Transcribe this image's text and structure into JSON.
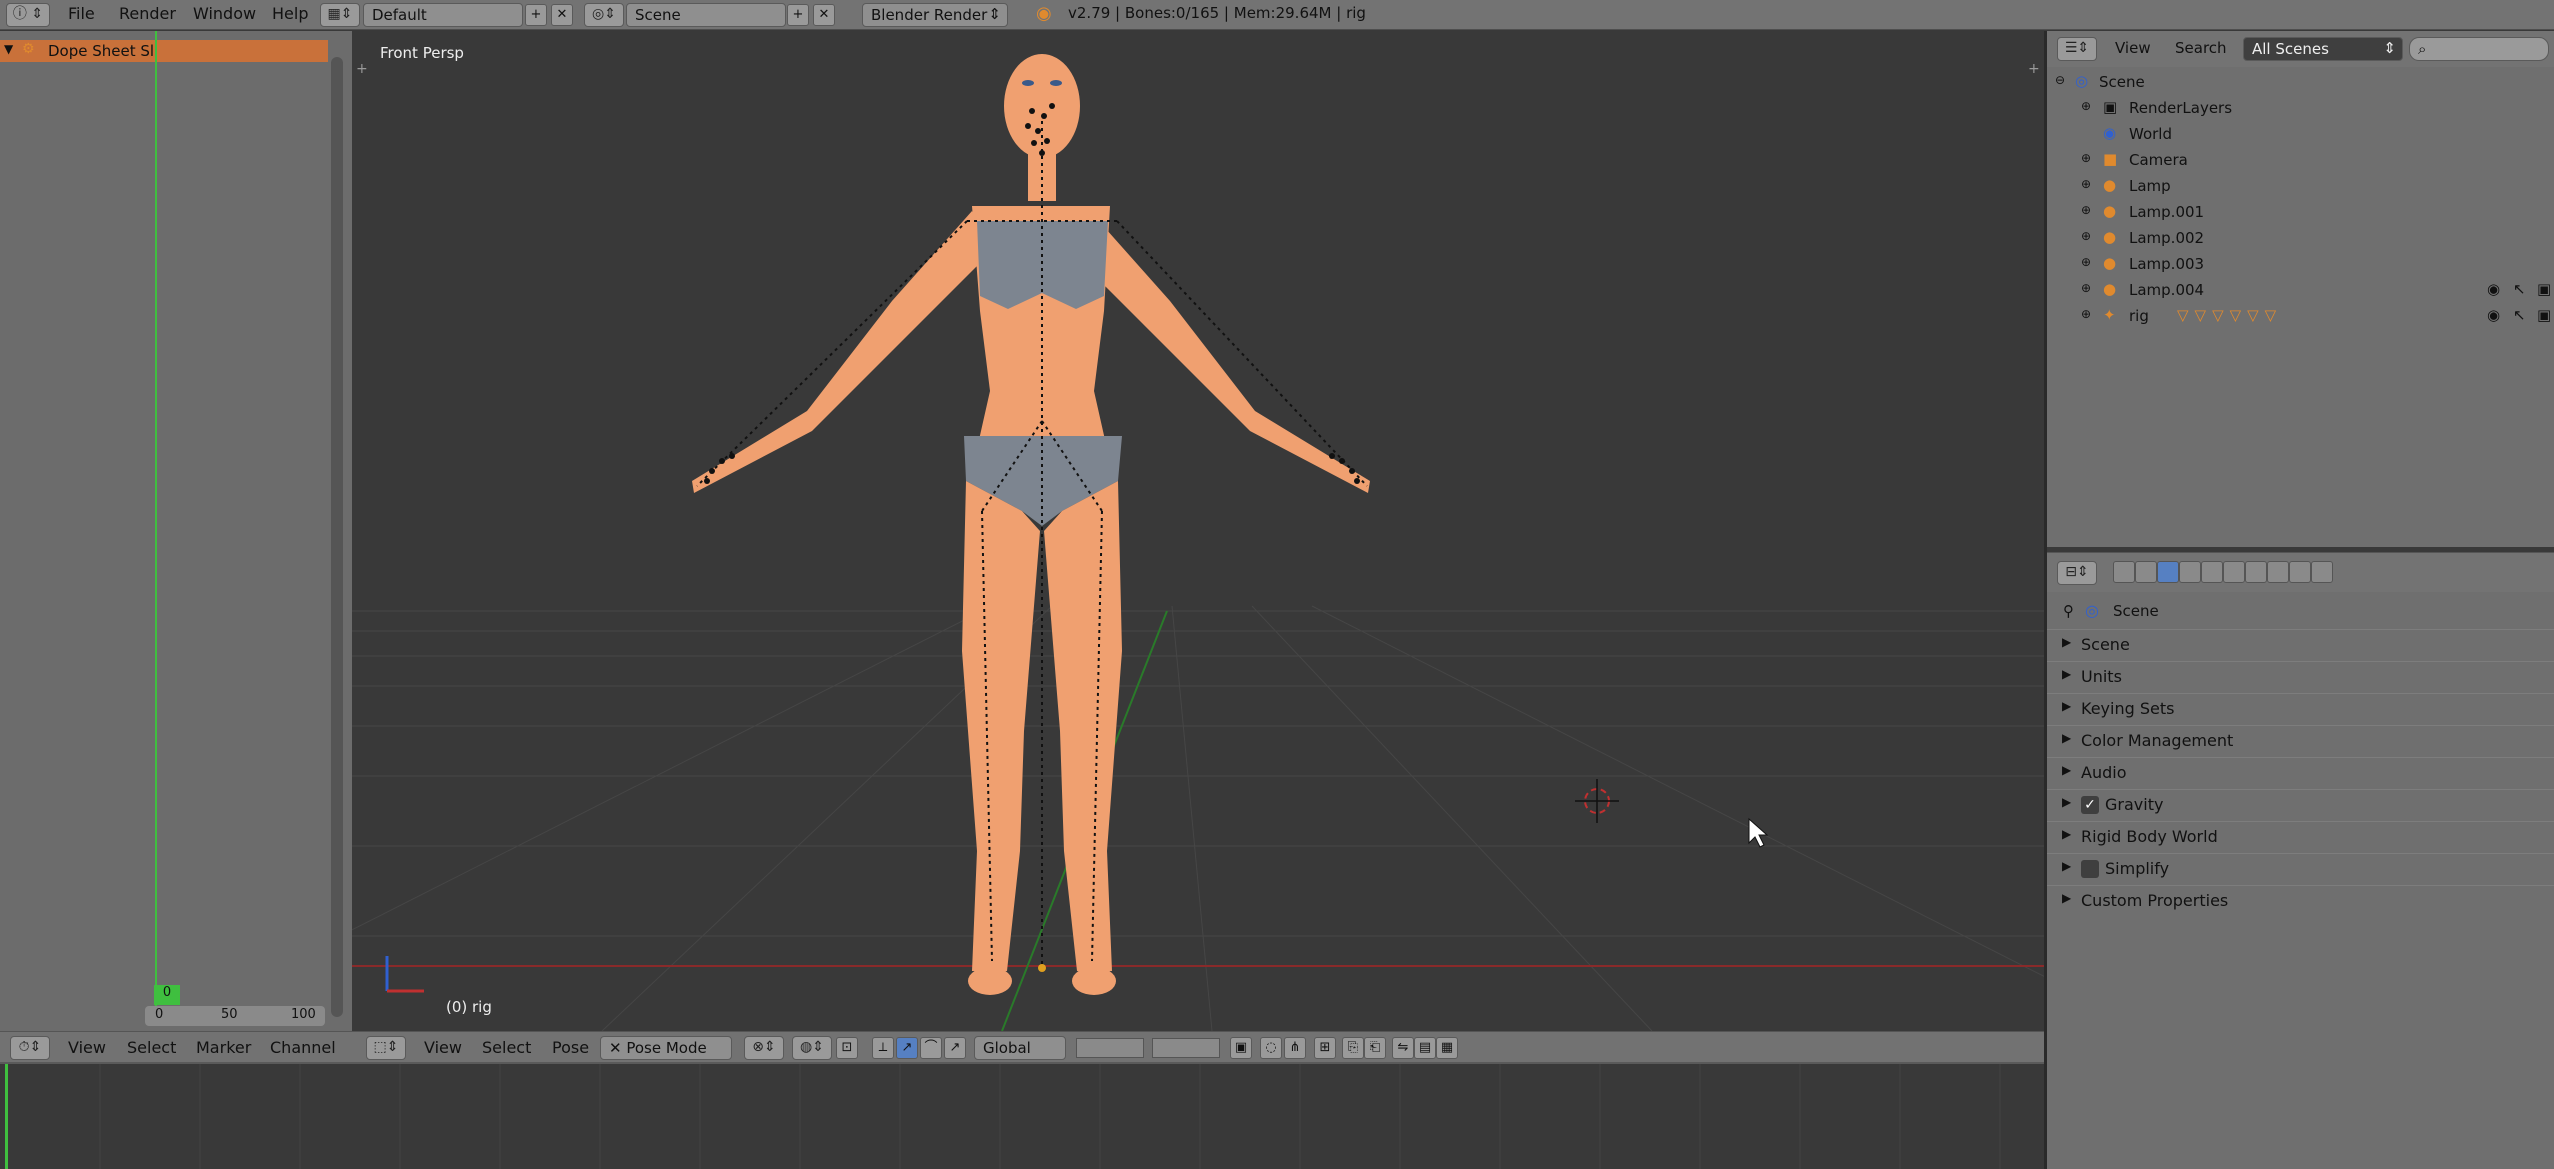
{
  "topbar": {
    "menus": [
      "File",
      "Render",
      "Window",
      "Help"
    ],
    "screen_layout": "Default",
    "scene": "Scene",
    "render_engine": "Blender Render",
    "stats": "v2.79 | Bones:0/165  | Mem:29.64M | rig"
  },
  "dopesheet": {
    "header_label": "Dope Sheet Sl",
    "current_frame": "0",
    "ruler": [
      "0",
      "50",
      "100"
    ],
    "menus": [
      "View",
      "Select",
      "Marker",
      "Channel"
    ]
  },
  "viewport": {
    "view_name": "Front Persp",
    "object_info": "(0) rig",
    "menus": [
      "View",
      "Select",
      "Pose"
    ],
    "mode": "Pose Mode",
    "orientation": "Global"
  },
  "outliner": {
    "menus": [
      "View",
      "Search"
    ],
    "display_mode": "All Scenes",
    "items": [
      {
        "label": "Scene",
        "icon": "scene-icon"
      },
      {
        "label": "RenderLayers",
        "icon": "renderlayers-icon"
      },
      {
        "label": "World",
        "icon": "world-icon"
      },
      {
        "label": "Camera",
        "icon": "camera-icon"
      },
      {
        "label": "Lamp",
        "icon": "lamp-icon"
      },
      {
        "label": "Lamp.001",
        "icon": "lamp-icon"
      },
      {
        "label": "Lamp.002",
        "icon": "lamp-icon"
      },
      {
        "label": "Lamp.003",
        "icon": "lamp-icon"
      },
      {
        "label": "Lamp.004",
        "icon": "lamp-icon"
      },
      {
        "label": "rig",
        "icon": "armature-icon"
      }
    ]
  },
  "properties": {
    "context": "Scene",
    "panels": [
      {
        "label": "Scene"
      },
      {
        "label": "Units"
      },
      {
        "label": "Keying Sets"
      },
      {
        "label": "Color Management"
      },
      {
        "label": "Audio"
      },
      {
        "label": "Gravity",
        "checkbox": true
      },
      {
        "label": "Rigid Body World"
      },
      {
        "label": "Simplify",
        "checkbox": false
      },
      {
        "label": "Custom Properties"
      }
    ]
  },
  "colors": {
    "accent_orange": "#e08a2e",
    "skin": "#f0a070",
    "clothing": "#7d8590",
    "grid_red": "#8a2a2a",
    "grid_green": "#2a7a2a"
  }
}
